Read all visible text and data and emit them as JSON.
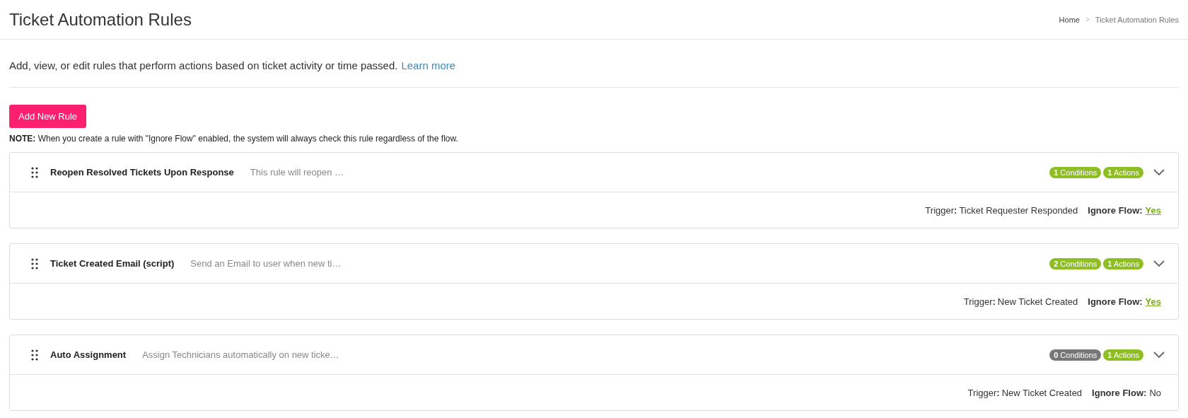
{
  "page_title": "Ticket Automation Rules",
  "breadcrumb": [
    {
      "label": "Home",
      "current": false
    },
    {
      "label": "Ticket Automation Rules",
      "current": true
    }
  ],
  "breadcrumb_separator": ">",
  "description": "Add, view, or edit rules that perform actions based on ticket activity or time passed.",
  "learn_more_link": "Learn more",
  "add_button": "Add New Rule",
  "note": "**NOTE:** When you create a rule with \"Ignore Flow\" enabled, the system will always check this rule regardless of the flow.",
  "rules": [
    {
      "name": "Reopen Resolved Tickets Upon Response",
      "summary": "This rule will reopen …",
      "badges": [
        {
          "text": "**1** Conditions",
          "color": "#8fbe24"
        },
        {
          "text": "**1** Actions",
          "color": "#8fbe24"
        }
      ],
      "trigger_label": "Trigger**:**",
      "trigger": "Ticket Requester Responded",
      "ignore_flow_label": "Ignore Flow:",
      "ignore_flow": "Yes",
      "ignore_flow_on": true
    },
    {
      "name": "Ticket Created Email (script)",
      "summary": "Send an Email to user when new ti…",
      "badges": [
        {
          "text": "**2** Conditions",
          "color": "#8fbe24"
        },
        {
          "text": "**1** Actions",
          "color": "#8fbe24"
        }
      ],
      "trigger_label": "Trigger**:**",
      "trigger": "New Ticket Created",
      "ignore_flow_label": "Ignore Flow:",
      "ignore_flow": "Yes",
      "ignore_flow_on": true
    },
    {
      "name": "Auto Assignment",
      "summary": "Assign Technicians automatically on new ticke…",
      "badges": [
        {
          "text": "**0** Conditions",
          "color": "#777777"
        },
        {
          "text": "**1** Actions",
          "color": "#8fbe24"
        }
      ],
      "trigger_label": "Trigger**:**",
      "trigger": "New Ticket Created",
      "ignore_flow_label": "Ignore Flow:",
      "ignore_flow": "No",
      "ignore_flow_on": false
    }
  ]
}
